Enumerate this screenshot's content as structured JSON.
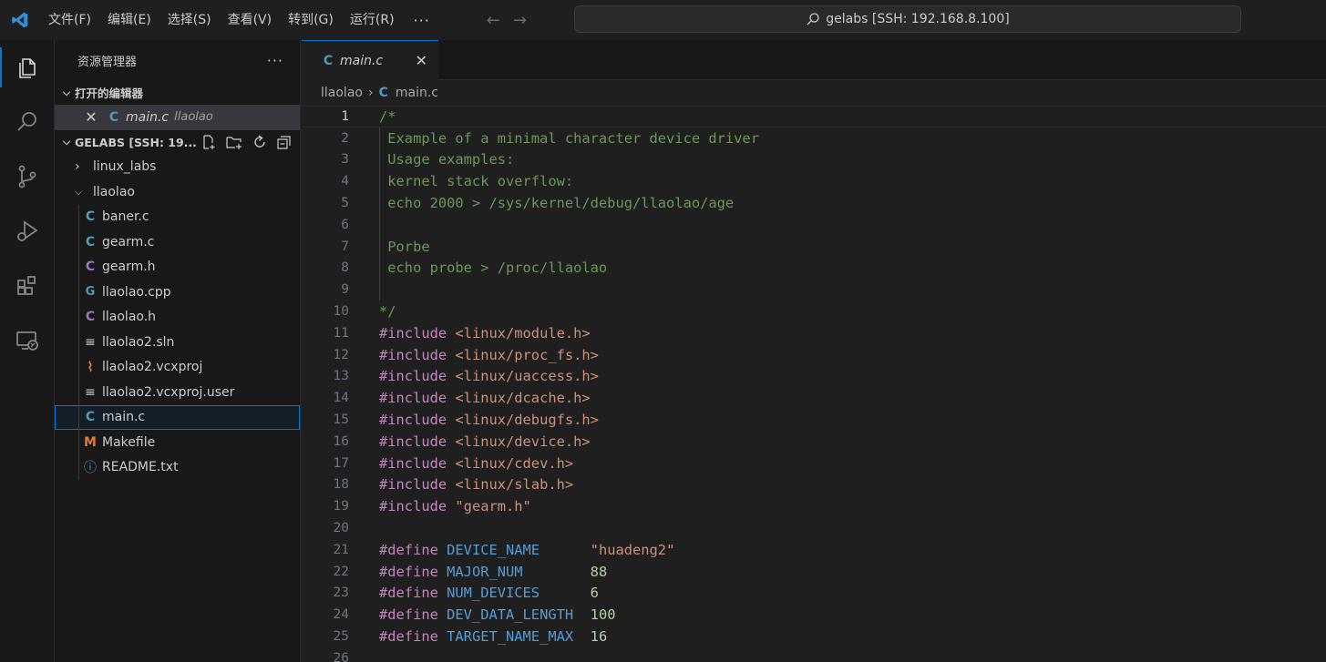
{
  "titlebar": {
    "menus": [
      "文件(F)",
      "编辑(E)",
      "选择(S)",
      "查看(V)",
      "转到(G)",
      "运行(R)"
    ],
    "more": "···",
    "search_text": "gelabs [SSH: 192.168.8.100]"
  },
  "sidebar": {
    "title": "资源管理器",
    "more": "···",
    "open_editors_label": "打开的编辑器",
    "open_editor": {
      "name": "main.c",
      "folder": "llaolao"
    },
    "workspace_label": "GELABS [SSH: 19...",
    "folders": [
      "linux_labs",
      "llaolao"
    ],
    "files": [
      {
        "name": "baner.c",
        "icon": "C",
        "color": "#519aba"
      },
      {
        "name": "gearm.c",
        "icon": "C",
        "color": "#519aba"
      },
      {
        "name": "gearm.h",
        "icon": "C",
        "color": "#a074c4"
      },
      {
        "name": "llaolao.cpp",
        "icon": "C+",
        "color": "#519aba"
      },
      {
        "name": "llaolao.h",
        "icon": "C",
        "color": "#a074c4"
      },
      {
        "name": "llaolao2.sln",
        "icon": "≡",
        "color": "#cccccc"
      },
      {
        "name": "llaolao2.vcxproj",
        "icon": "rss",
        "color": "#e37933"
      },
      {
        "name": "llaolao2.vcxproj.user",
        "icon": "≡",
        "color": "#cccccc"
      },
      {
        "name": "main.c",
        "icon": "C",
        "color": "#519aba"
      },
      {
        "name": "Makefile",
        "icon": "M",
        "color": "#e37933"
      },
      {
        "name": "README.txt",
        "icon": "ⓘ",
        "color": "#519aba"
      }
    ]
  },
  "editor": {
    "tab_label": "main.c",
    "breadcrumb_folder": "llaolao",
    "breadcrumb_file": "main.c",
    "lines": [
      {
        "n": "1",
        "parts": [
          {
            "t": "/*",
            "c": "c-cm"
          }
        ]
      },
      {
        "n": "2",
        "parts": [
          {
            "t": " Example of a minimal character device driver",
            "c": "c-cm"
          }
        ]
      },
      {
        "n": "3",
        "parts": [
          {
            "t": " Usage examples:",
            "c": "c-cm"
          }
        ]
      },
      {
        "n": "4",
        "parts": [
          {
            "t": " kernel stack overflow:",
            "c": "c-cm"
          }
        ]
      },
      {
        "n": "5",
        "parts": [
          {
            "t": " echo 2000 > /sys/kernel/debug/llaolao/age",
            "c": "c-cm"
          }
        ]
      },
      {
        "n": "6",
        "parts": []
      },
      {
        "n": "7",
        "parts": [
          {
            "t": " Porbe",
            "c": "c-cm"
          }
        ]
      },
      {
        "n": "8",
        "parts": [
          {
            "t": " echo probe > /proc/llaolao",
            "c": "c-cm"
          }
        ]
      },
      {
        "n": "9",
        "parts": []
      },
      {
        "n": "10",
        "parts": [
          {
            "t": "*/",
            "c": "c-cm"
          }
        ]
      },
      {
        "n": "11",
        "parts": [
          {
            "t": "#include ",
            "c": "c-pp"
          },
          {
            "t": "<linux/module.h>",
            "c": "c-str"
          }
        ]
      },
      {
        "n": "12",
        "parts": [
          {
            "t": "#include ",
            "c": "c-pp"
          },
          {
            "t": "<linux/proc_fs.h>",
            "c": "c-str"
          }
        ]
      },
      {
        "n": "13",
        "parts": [
          {
            "t": "#include ",
            "c": "c-pp"
          },
          {
            "t": "<linux/uaccess.h>",
            "c": "c-str"
          }
        ]
      },
      {
        "n": "14",
        "parts": [
          {
            "t": "#include ",
            "c": "c-pp"
          },
          {
            "t": "<linux/dcache.h>",
            "c": "c-str"
          }
        ]
      },
      {
        "n": "15",
        "parts": [
          {
            "t": "#include ",
            "c": "c-pp"
          },
          {
            "t": "<linux/debugfs.h>",
            "c": "c-str"
          }
        ]
      },
      {
        "n": "16",
        "parts": [
          {
            "t": "#include ",
            "c": "c-pp"
          },
          {
            "t": "<linux/device.h>",
            "c": "c-str"
          }
        ]
      },
      {
        "n": "17",
        "parts": [
          {
            "t": "#include ",
            "c": "c-pp"
          },
          {
            "t": "<linux/cdev.h>",
            "c": "c-str"
          }
        ]
      },
      {
        "n": "18",
        "parts": [
          {
            "t": "#include ",
            "c": "c-pp"
          },
          {
            "t": "<linux/slab.h>",
            "c": "c-str"
          }
        ]
      },
      {
        "n": "19",
        "parts": [
          {
            "t": "#include ",
            "c": "c-pp"
          },
          {
            "t": "\"gearm.h\"",
            "c": "c-str"
          }
        ]
      },
      {
        "n": "20",
        "parts": []
      },
      {
        "n": "21",
        "parts": [
          {
            "t": "#define ",
            "c": "c-pp"
          },
          {
            "t": "DEVICE_NAME      ",
            "c": "c-mac"
          },
          {
            "t": "\"huadeng2\"",
            "c": "c-str"
          }
        ]
      },
      {
        "n": "22",
        "parts": [
          {
            "t": "#define ",
            "c": "c-pp"
          },
          {
            "t": "MAJOR_NUM        ",
            "c": "c-mac"
          },
          {
            "t": "88",
            "c": "c-num"
          }
        ]
      },
      {
        "n": "23",
        "parts": [
          {
            "t": "#define ",
            "c": "c-pp"
          },
          {
            "t": "NUM_DEVICES      ",
            "c": "c-mac"
          },
          {
            "t": "6",
            "c": "c-num"
          }
        ]
      },
      {
        "n": "24",
        "parts": [
          {
            "t": "#define ",
            "c": "c-pp"
          },
          {
            "t": "DEV_DATA_LENGTH  ",
            "c": "c-mac"
          },
          {
            "t": "100",
            "c": "c-num"
          }
        ]
      },
      {
        "n": "25",
        "parts": [
          {
            "t": "#define ",
            "c": "c-pp"
          },
          {
            "t": "TARGET_NAME_MAX  ",
            "c": "c-mac"
          },
          {
            "t": "16",
            "c": "c-num"
          }
        ]
      },
      {
        "n": "26",
        "parts": []
      }
    ]
  }
}
